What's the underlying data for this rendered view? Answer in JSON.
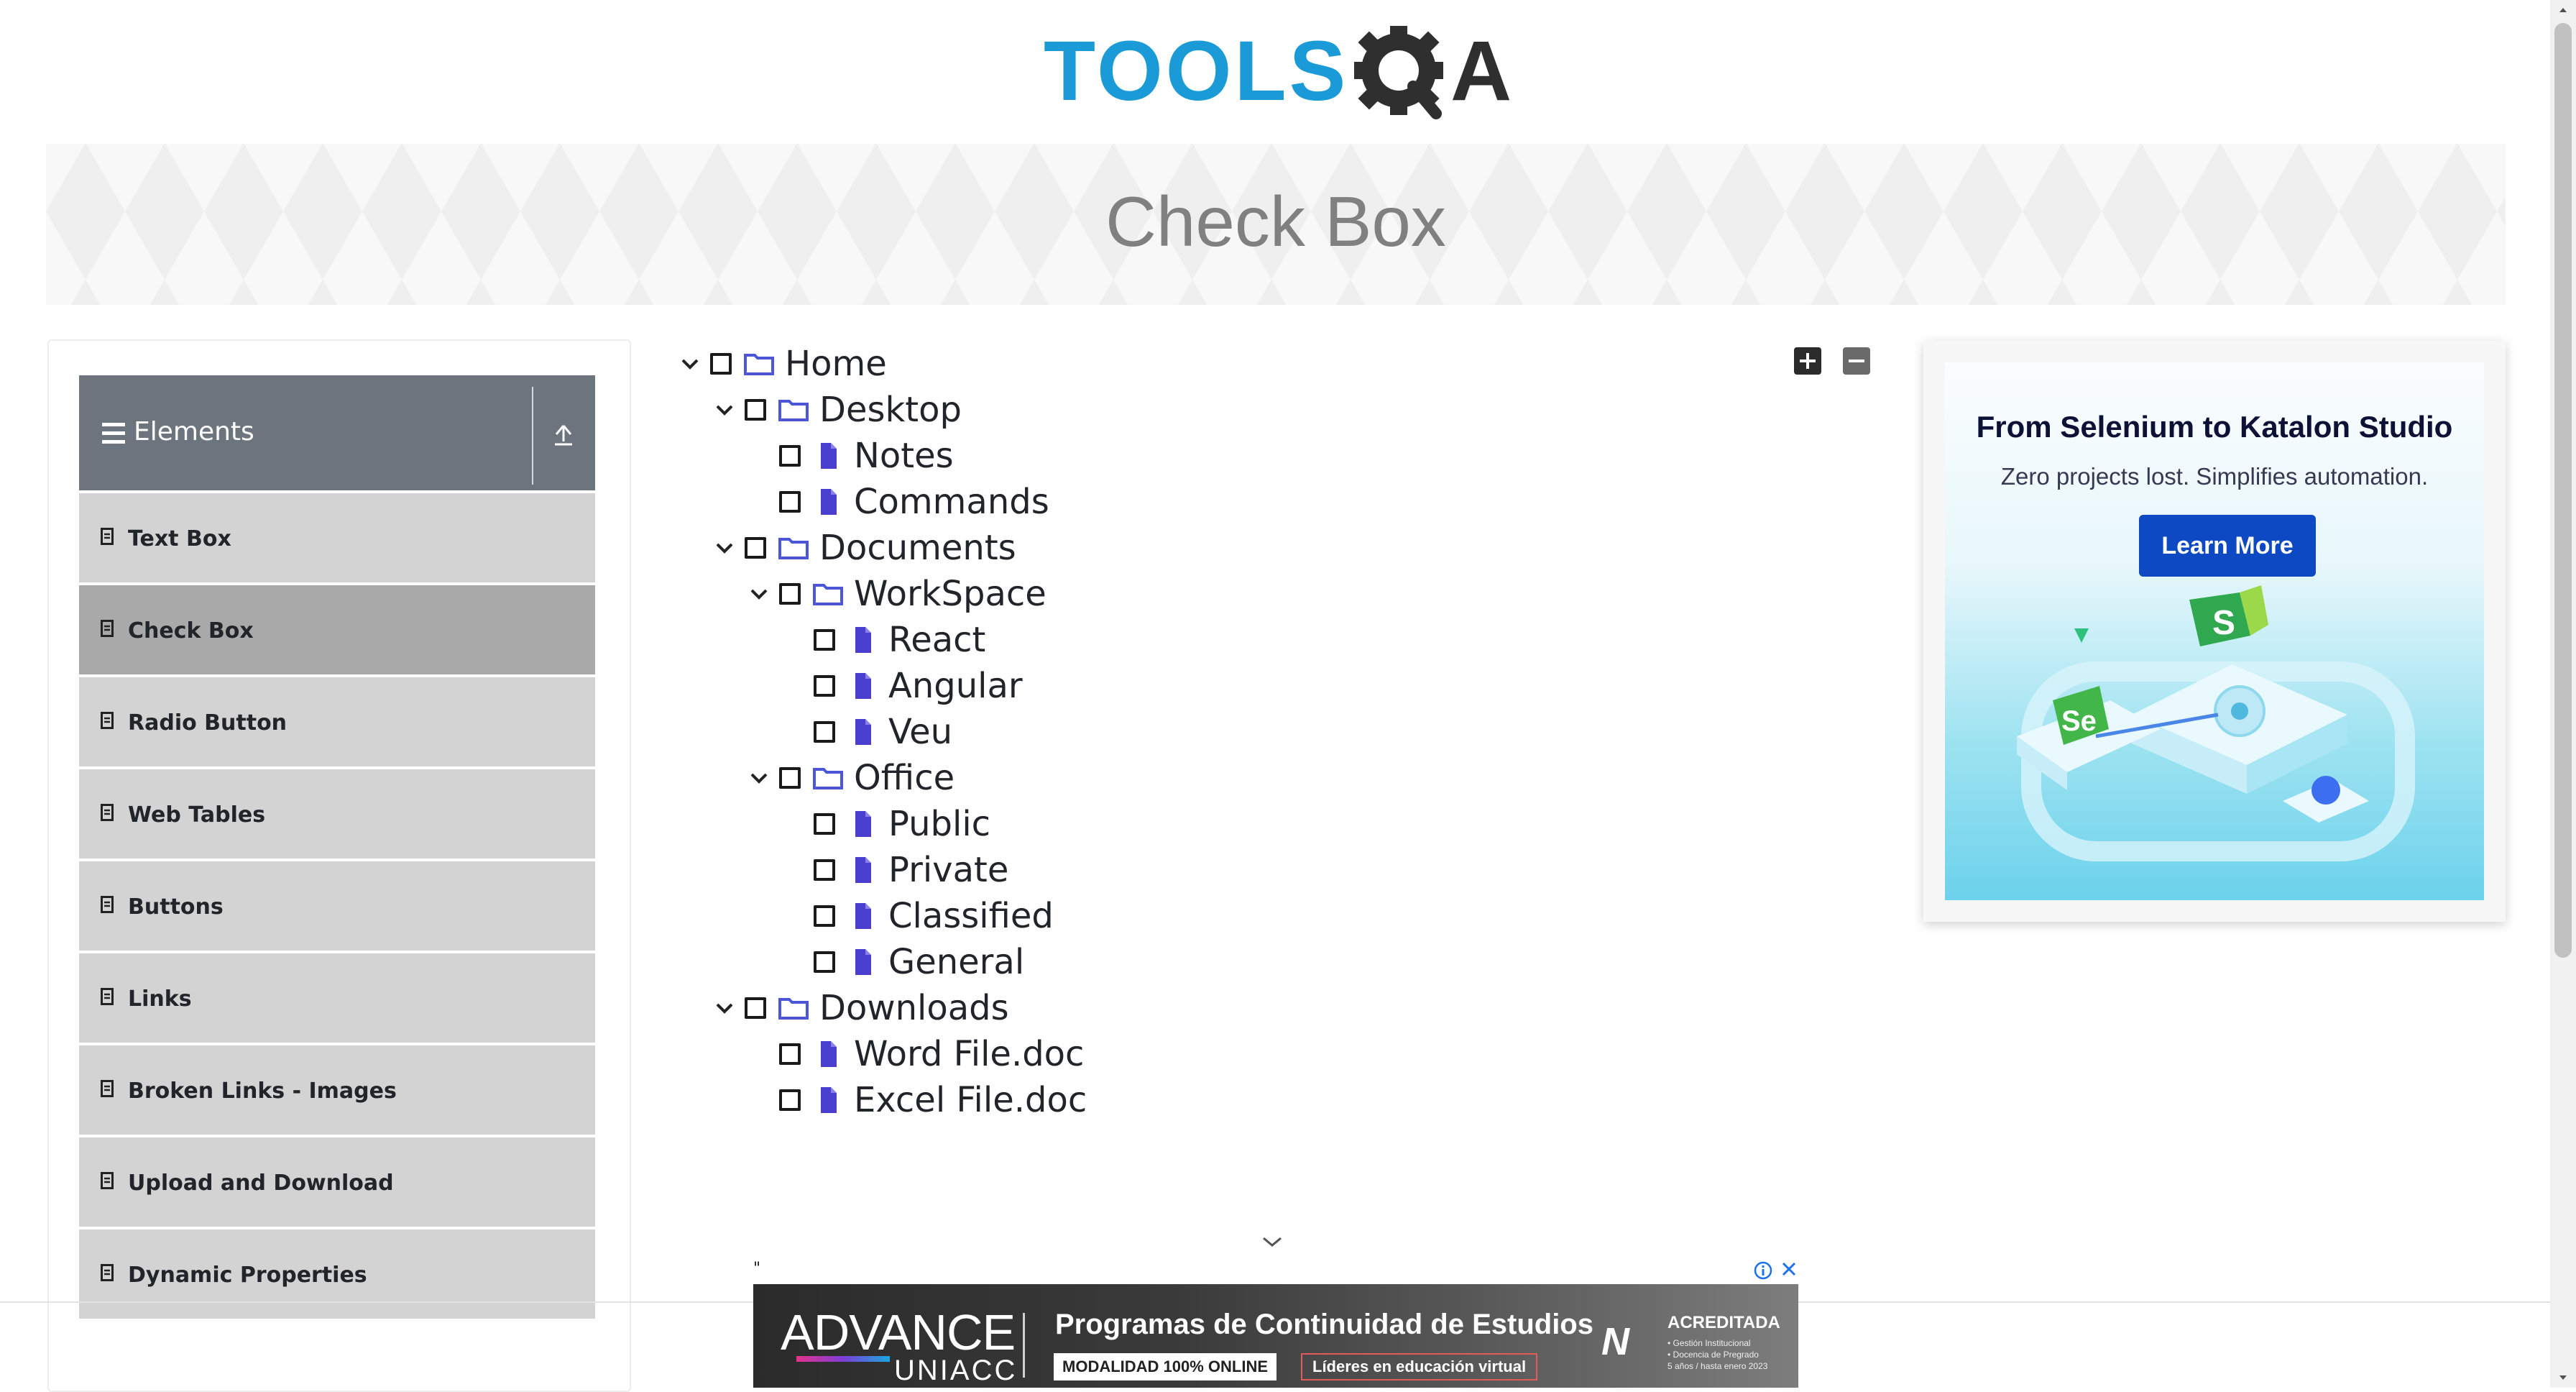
{
  "logo": {
    "text_main": "TOOLS",
    "text_tail": "A",
    "brand_color": "#1a9bd7"
  },
  "page": {
    "title": "Check Box"
  },
  "sidebar": {
    "group_title": "Elements",
    "items": [
      {
        "label": "Text Box"
      },
      {
        "label": "Check Box",
        "active": true
      },
      {
        "label": "Radio Button"
      },
      {
        "label": "Web Tables"
      },
      {
        "label": "Buttons"
      },
      {
        "label": "Links"
      },
      {
        "label": "Broken Links - Images"
      },
      {
        "label": "Upload and Download"
      },
      {
        "label": "Dynamic Properties"
      }
    ]
  },
  "tree": {
    "nodes": [
      {
        "label": "Home",
        "type": "folder",
        "expanded": true
      },
      {
        "label": "Desktop",
        "type": "folder",
        "expanded": true
      },
      {
        "label": "Notes",
        "type": "file"
      },
      {
        "label": "Commands",
        "type": "file"
      },
      {
        "label": "Documents",
        "type": "folder",
        "expanded": true
      },
      {
        "label": "WorkSpace",
        "type": "folder",
        "expanded": true
      },
      {
        "label": "React",
        "type": "file"
      },
      {
        "label": "Angular",
        "type": "file"
      },
      {
        "label": "Veu",
        "type": "file"
      },
      {
        "label": "Office",
        "type": "folder",
        "expanded": true
      },
      {
        "label": "Public",
        "type": "file"
      },
      {
        "label": "Private",
        "type": "file"
      },
      {
        "label": "Classified",
        "type": "file"
      },
      {
        "label": "General",
        "type": "file"
      },
      {
        "label": "Downloads",
        "type": "folder",
        "expanded": true
      },
      {
        "label": "Word File.doc",
        "type": "file"
      },
      {
        "label": "Excel File.doc",
        "type": "file"
      }
    ]
  },
  "side_ad": {
    "title": "From Selenium to Katalon Studio",
    "subtitle": "Zero projects lost. Simplifies automation.",
    "button_label": "Learn More",
    "badge_s": "S",
    "badge_se": "Se"
  },
  "bottom_ad": {
    "quote": "\"",
    "brand": "ADVANCE",
    "brand_sub": "UNIACC",
    "headline": "Programas de Continuidad de Estudios",
    "pill1": "MODALIDAD 100% ONLINE",
    "pill2": "Líderes en educación virtual",
    "badge_mark": "N",
    "acred_title": "ACREDITADA",
    "acred_line1": "• Gestión Institucional",
    "acred_line2": "• Docencia de Pregrado",
    "acred_line3": "5 años / hasta enero 2023"
  },
  "colors": {
    "folder_icon": "#4b57d6",
    "file_icon": "#4b3fd0",
    "sidebar_header": "#6c757d",
    "sidebar_item": "#d3d3d3",
    "sidebar_item_active": "#a9a9a9",
    "ad_button": "#0d49c2"
  }
}
